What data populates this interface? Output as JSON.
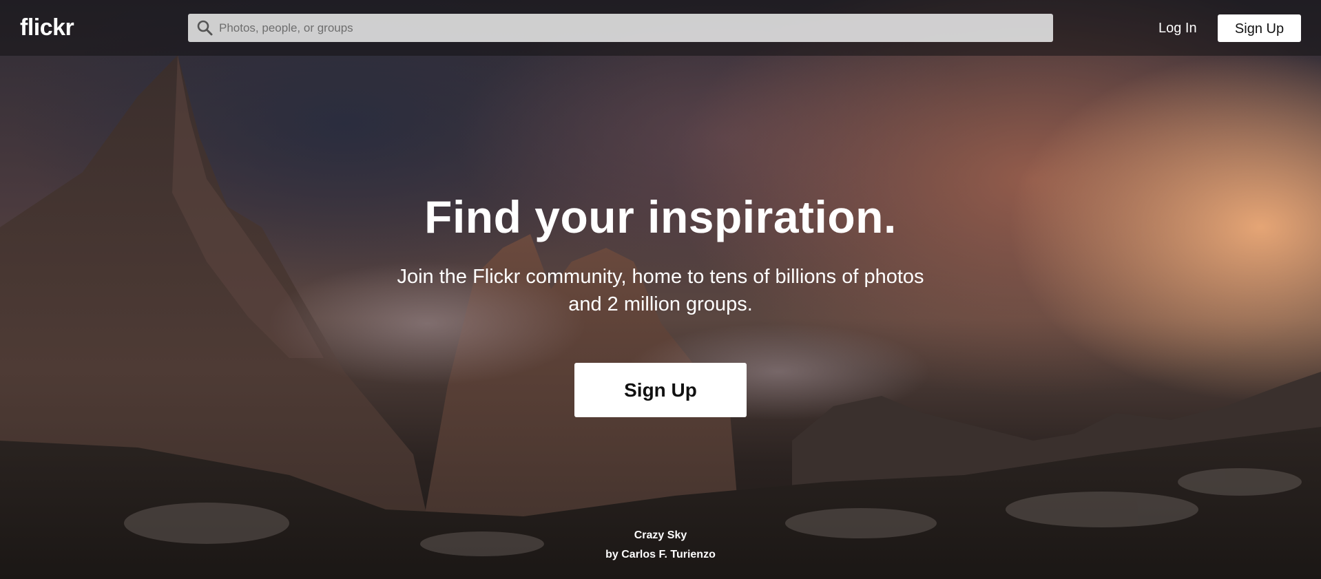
{
  "header": {
    "logo": "flickr",
    "search": {
      "placeholder": "Photos, people, or groups",
      "value": ""
    },
    "login_label": "Log In",
    "signup_label": "Sign Up"
  },
  "hero": {
    "title": "Find your inspiration.",
    "subtitle": "Join the Flickr community, home to tens of billions of photos and 2 million groups.",
    "signup_label": "Sign Up"
  },
  "photo_credit": {
    "title": "Crazy Sky",
    "author": "by Carlos F. Turienzo"
  },
  "colors": {
    "header_bg": "#141214",
    "button_bg": "#ffffff",
    "text": "#ffffff"
  },
  "icons": {
    "search": "search-icon"
  }
}
